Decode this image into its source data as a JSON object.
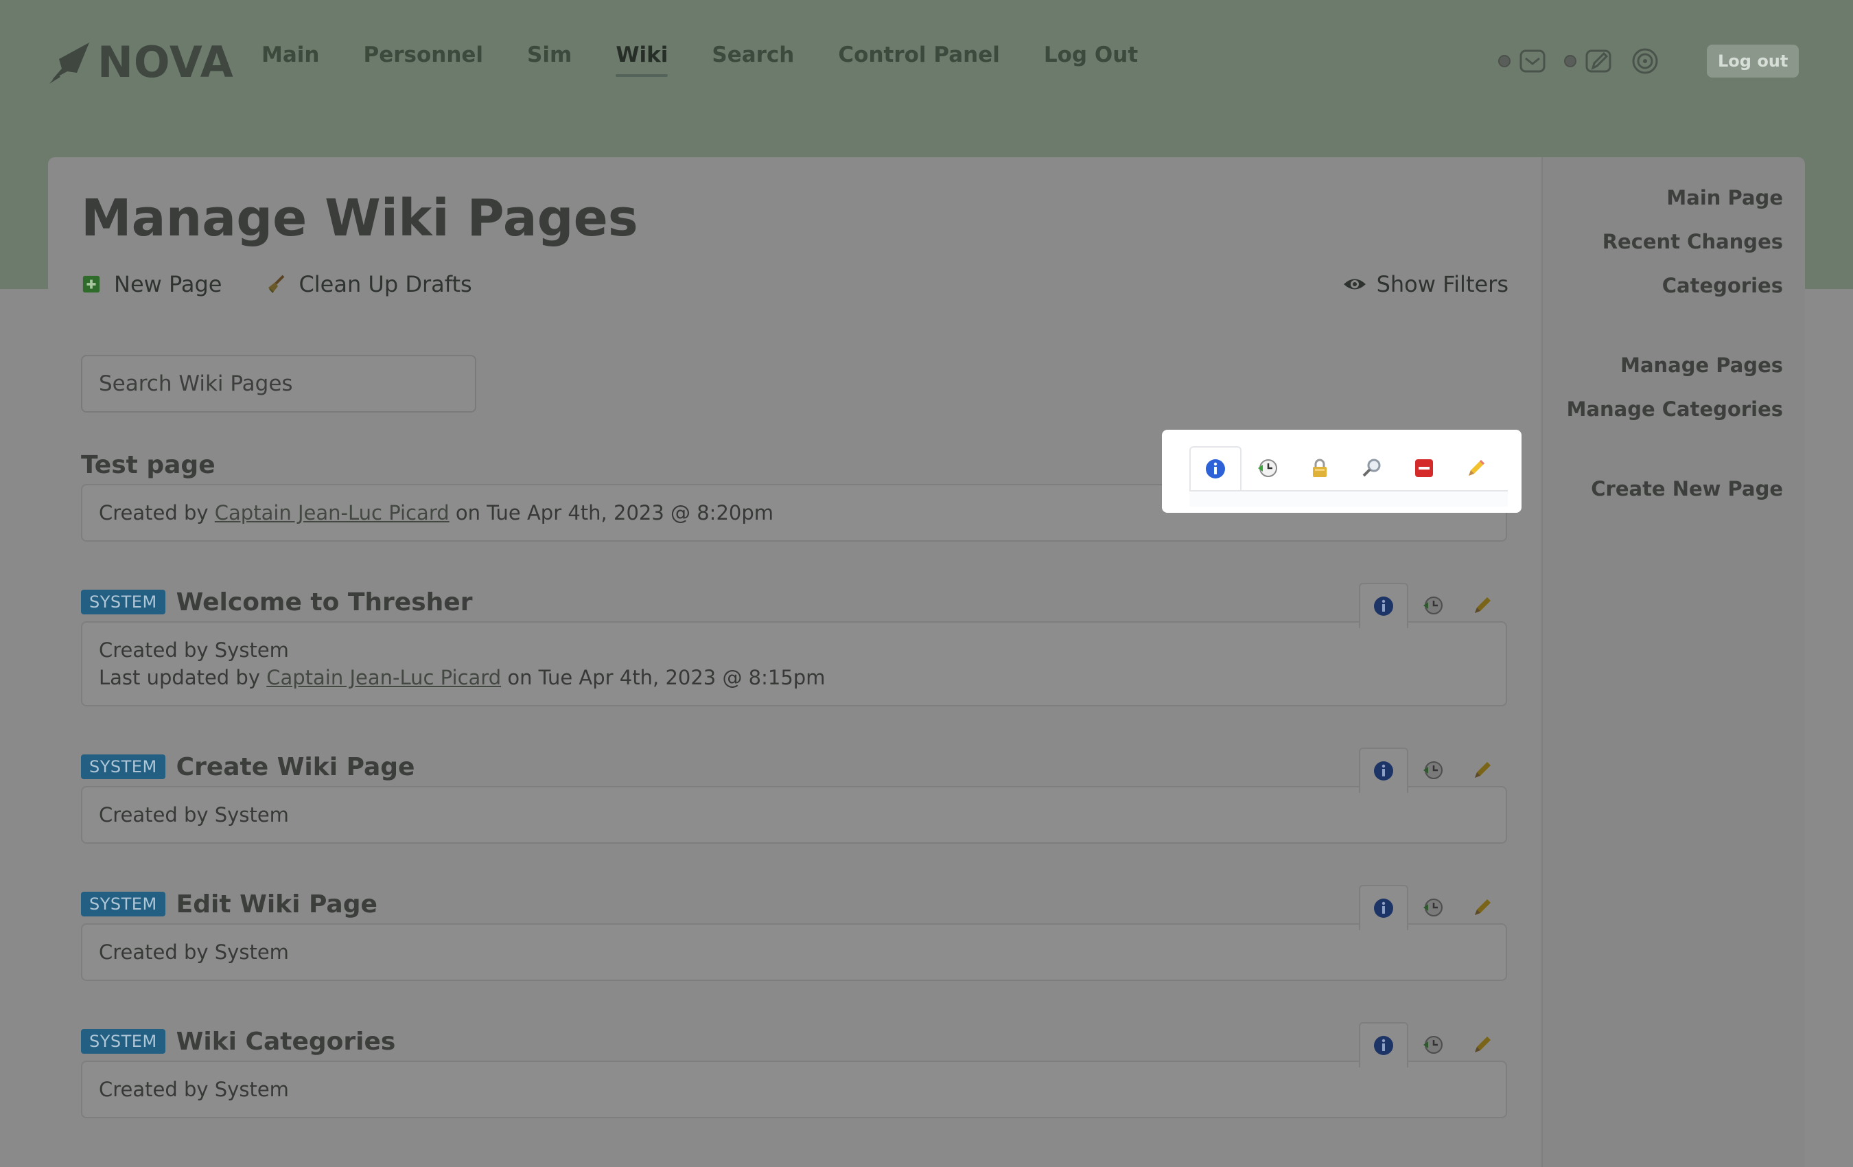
{
  "logo": {
    "text": "NOVA"
  },
  "nav": [
    "Main",
    "Personnel",
    "Sim",
    "Wiki",
    "Search",
    "Control Panel",
    "Log Out"
  ],
  "nav_active": "Wiki",
  "header": {
    "logout_label": "Log out",
    "icons": [
      "mail-icon",
      "writing-icon",
      "target-icon"
    ]
  },
  "page": {
    "title": "Manage Wiki Pages",
    "new_page": "New Page",
    "clean_up_drafts": "Clean Up Drafts",
    "show_filters": "Show Filters",
    "search_placeholder": "Search Wiki Pages"
  },
  "entries": [
    {
      "title": "Test page",
      "badge": "",
      "created_prefix": "Created by ",
      "created_author": "Captain Jean-Luc Picard",
      "created_suffix": " on Tue Apr 4th, 2023 @ 8:20pm",
      "tools": [
        "info",
        "history",
        "lock",
        "view",
        "delete",
        "edit"
      ]
    },
    {
      "title": "Welcome to Thresher",
      "badge": "SYSTEM",
      "created_text": "Created by System",
      "updated_prefix": "Last updated by ",
      "updated_author": "Captain Jean-Luc Picard",
      "updated_suffix": " on Tue Apr 4th, 2023 @ 8:15pm",
      "tools": [
        "info",
        "history",
        "edit"
      ]
    },
    {
      "title": "Create Wiki Page",
      "badge": "SYSTEM",
      "created_text": "Created by System",
      "tools": [
        "info",
        "history",
        "edit"
      ]
    },
    {
      "title": "Edit Wiki Page",
      "badge": "SYSTEM",
      "created_text": "Created by System",
      "tools": [
        "info",
        "history",
        "edit"
      ]
    },
    {
      "title": "Wiki Categories",
      "badge": "SYSTEM",
      "created_text": "Created by System",
      "tools": [
        "info",
        "history",
        "edit"
      ]
    }
  ],
  "sidebar": [
    [
      "Main Page",
      "Recent Changes",
      "Categories"
    ],
    [
      "Manage Pages",
      "Manage Categories"
    ],
    [
      "Create New Page"
    ]
  ],
  "colors": {
    "system_badge": "#225f82",
    "header_band": "#6c7b6b",
    "overlay": "#8a8a8a"
  }
}
